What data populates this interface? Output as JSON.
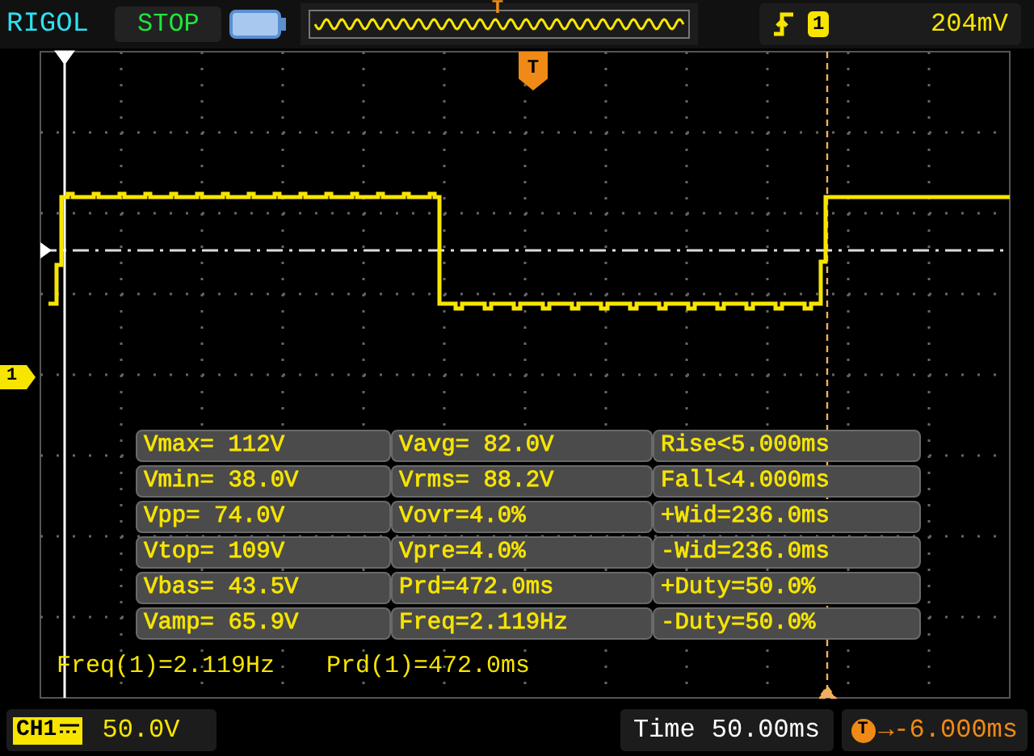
{
  "top_bar": {
    "brand": "RIGOL",
    "run_state": "STOP",
    "overview_marker": "T",
    "trigger": {
      "channel": "1",
      "level": "204mV"
    }
  },
  "screen": {
    "trigger_marker": "T",
    "channel_marker": "1",
    "measurements": [
      [
        "Vmax= 112V",
        "Vavg= 82.0V",
        "Rise<5.000ms"
      ],
      [
        "Vmin= 38.0V",
        "Vrms= 88.2V",
        "Fall<4.000ms"
      ],
      [
        "Vpp= 74.0V",
        "Vovr=4.0%",
        "+Wid=236.0ms"
      ],
      [
        "Vtop= 109V",
        "Vpre=4.0%",
        "-Wid=236.0ms"
      ],
      [
        "Vbas= 43.5V",
        "Prd=472.0ms",
        "+Duty=50.0%"
      ],
      [
        "Vamp= 65.9V",
        "Freq=2.119Hz",
        "-Duty=50.0%"
      ]
    ],
    "readouts": [
      "Freq(1)=2.119Hz",
      "Prd(1)=472.0ms"
    ]
  },
  "bottom_bar": {
    "channel": {
      "label": "CH1",
      "scale": "50.0V"
    },
    "timebase": {
      "label": "Time",
      "value": "50.00ms"
    },
    "trigger_offset": {
      "marker": "T",
      "value": "→-6.000ms"
    }
  }
}
